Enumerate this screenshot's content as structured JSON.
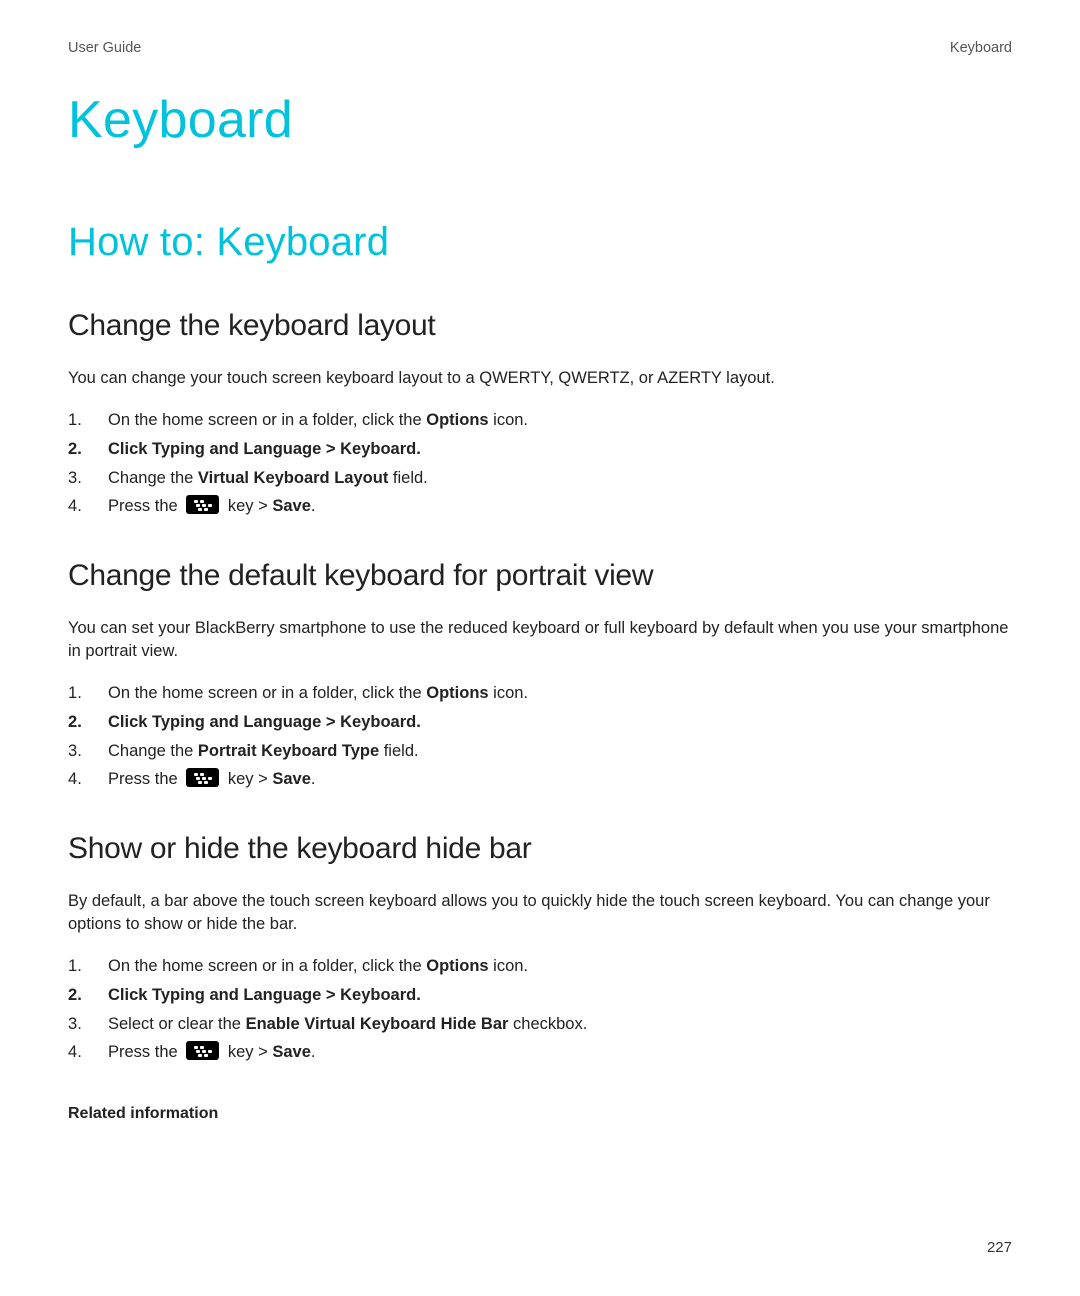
{
  "header": {
    "left": "User Guide",
    "right": "Keyboard"
  },
  "title": "Keyboard",
  "section": "How to: Keyboard",
  "groups": [
    {
      "heading": "Change the keyboard layout",
      "intro": "You can change your touch screen keyboard layout to a QWERTY, QWERTZ, or AZERTY layout.",
      "steps": [
        {
          "pre": "On the home screen or in a folder, click the ",
          "b1": "Options",
          "post": " icon."
        },
        {
          "pre": "Click ",
          "b1": "Typing and Language",
          "mid": " > ",
          "b2": "Keyboard",
          "post": ".",
          "allbold": true
        },
        {
          "pre": "Change the ",
          "b1": "Virtual Keyboard Layout",
          "post": " field."
        },
        {
          "pre": "Press the ",
          "icon": true,
          "mid": " key > ",
          "b2": "Save",
          "post": "."
        }
      ]
    },
    {
      "heading": "Change the default keyboard for portrait view",
      "intro": "You can set your BlackBerry smartphone to use the reduced keyboard or full keyboard by default when you use your smartphone in portrait view.",
      "steps": [
        {
          "pre": "On the home screen or in a folder, click the ",
          "b1": "Options",
          "post": " icon."
        },
        {
          "pre": "Click ",
          "b1": "Typing and Language",
          "mid": " > ",
          "b2": "Keyboard",
          "post": ".",
          "allbold": true
        },
        {
          "pre": "Change the ",
          "b1": "Portrait Keyboard Type",
          "post": " field."
        },
        {
          "pre": "Press the ",
          "icon": true,
          "mid": " key > ",
          "b2": "Save",
          "post": "."
        }
      ]
    },
    {
      "heading": "Show or hide the keyboard hide bar",
      "intro": "By default, a bar above the touch screen keyboard allows you to quickly hide the touch screen keyboard. You can change your options to show or hide the bar.",
      "steps": [
        {
          "pre": "On the home screen or in a folder, click the ",
          "b1": "Options",
          "post": " icon."
        },
        {
          "pre": "Click ",
          "b1": "Typing and Language",
          "mid": " > ",
          "b2": "Keyboard",
          "post": ".",
          "allbold": true
        },
        {
          "pre": "Select or clear the ",
          "b1": "Enable Virtual Keyboard Hide Bar",
          "post": " checkbox."
        },
        {
          "pre": "Press the ",
          "icon": true,
          "mid": " key > ",
          "b2": "Save",
          "post": "."
        }
      ]
    }
  ],
  "related": "Related information",
  "pageNumber": "227"
}
